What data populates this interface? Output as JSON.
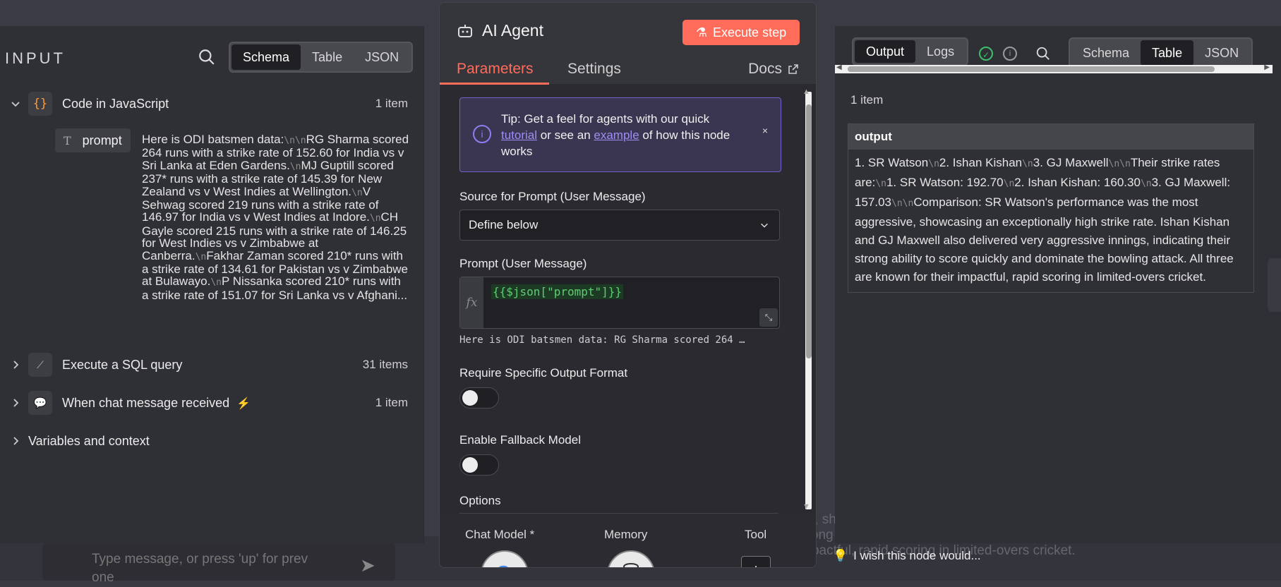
{
  "background": {
    "chat_placeholder": "Type message, or press 'up' for prev one",
    "ghost_text": "e most aggressive, showcasing an exceptionally high strike rate. Ishan Kishan ... innings, indicating their strong ability to score quickly and dominate the bowling attack. All three are known for their impactful, rapid scoring in limited-overs cricket."
  },
  "input_panel": {
    "title": "INPUT",
    "view_tabs": [
      "Schema",
      "Table",
      "JSON"
    ],
    "active_tab": "Schema",
    "nodes": [
      {
        "label": "Code in JavaScript",
        "count": "1 item",
        "icon": "code-braces-icon",
        "expanded": true
      },
      {
        "label": "Execute a SQL query",
        "count": "31 items",
        "icon": "sql-icon",
        "expanded": false
      },
      {
        "label": "When chat message received",
        "count": "1 item",
        "icon": "chat-icon",
        "expanded": false,
        "trigger": true
      },
      {
        "label": "Variables and context",
        "count": "",
        "expanded": false
      }
    ],
    "field": {
      "type_icon": "T",
      "name": "prompt",
      "value_segments": [
        "Here is ODI batsmen data:",
        "RG Sharma scored 264 runs with a strike rate of 152.60 for India vs v Sri Lanka at Eden Gardens.",
        "MJ Guptill scored 237* runs with a strike rate of 145.39 for New Zealand vs v West Indies at Wellington.",
        "V Sehwag scored 219 runs with a strike rate of 146.97 for India vs v West Indies at Indore.",
        "CH Gayle scored 215 runs with a strike rate of 146.25 for West Indies vs v Zimbabwe at Canberra.",
        "Fakhar Zaman scored 210* runs with a strike rate of 134.61 for Pakistan vs v Zimbabwe at Bulawayo.",
        "P Nissanka scored 210* runs with a strike rate of 151.07 for Sri Lanka vs v Afghani..."
      ]
    }
  },
  "modal": {
    "title": "AI Agent",
    "execute_label": "Execute step",
    "tabs": [
      "Parameters",
      "Settings"
    ],
    "active_tab": "Parameters",
    "docs_label": "Docs",
    "tip": {
      "prefix": "Tip: Get a feel for agents with our quick",
      "link1": "tutorial",
      "middle": "or see an",
      "link2": "example",
      "suffix": "of how this node works",
      "close": "×"
    },
    "source_label": "Source for Prompt (User Message)",
    "source_value": "Define below",
    "prompt_label": "Prompt (User Message)",
    "prompt_expression": "{{$json[\"prompt\"]}}",
    "prompt_preview": "Here is ODI batsmen data: RG Sharma scored 264 …",
    "require_format_label": "Require Specific Output Format",
    "require_format_on": false,
    "fallback_label": "Enable Fallback Model",
    "fallback_on": false,
    "options_label": "Options",
    "connectors": [
      "Chat Model *",
      "Memory",
      "Tool"
    ]
  },
  "output_panel": {
    "tabs_left": [
      "Output",
      "Logs"
    ],
    "active_left": "Output",
    "view_tabs": [
      "Schema",
      "Table",
      "JSON"
    ],
    "active_view": "Table",
    "count": "1 item",
    "column": "output",
    "value_segments": [
      "1. SR Watson",
      "2. Ishan Kishan",
      "3. GJ Maxwell",
      "Their strike rates are:",
      "1. SR Watson: 192.70",
      "2. Ishan Kishan: 160.30",
      "3. GJ Maxwell: 157.03",
      "Comparison: SR Watson's performance was the most aggressive, showcasing an exceptionally high strike rate. Ishan Kishan and GJ Maxwell also delivered very aggressive innings, indicating their strong ability to score quickly and dominate the bowling attack. All three are known for their impactful, rapid scoring in limited-overs cricket."
    ]
  },
  "footer": {
    "wish_label": "I wish this node would..."
  },
  "colors": {
    "accent": "#ff6d5a",
    "tip_border": "#6f62c9",
    "success": "#3cbf6a"
  }
}
